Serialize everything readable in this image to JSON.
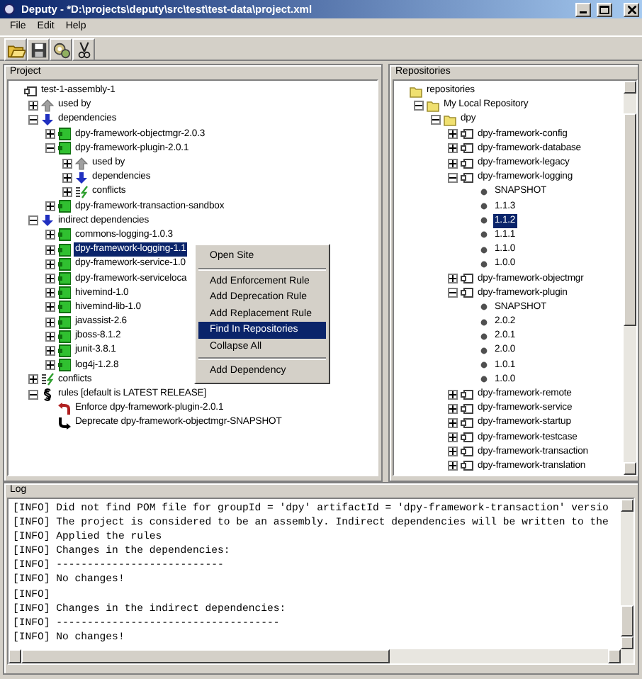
{
  "window": {
    "title": "Deputy - *D:\\projects\\deputy\\src\\test\\test-data\\project.xml"
  },
  "menu": [
    "File",
    "Edit",
    "Help"
  ],
  "toolbar": [
    {
      "kind": "open"
    },
    {
      "kind": "save"
    },
    {
      "kind": "resolve"
    },
    {
      "kind": "cut"
    }
  ],
  "project": {
    "title": "Project",
    "tree": [
      {
        "label": "test-1-assembly-1",
        "kind": "artifact",
        "selected": false,
        "children": [
          {
            "label": "used by",
            "kind": "up",
            "expanded": false,
            "selected": false
          },
          {
            "label": "dependencies",
            "kind": "down",
            "expanded": true,
            "selected": false,
            "children": [
              {
                "label": "dpy-framework-objectmgr-2.0.3",
                "kind": "module",
                "expanded": false,
                "selected": false
              },
              {
                "label": "dpy-framework-plugin-2.0.1",
                "kind": "module",
                "expanded": true,
                "selected": false,
                "children": [
                  {
                    "label": "used by",
                    "kind": "up",
                    "expanded": false,
                    "selected": false
                  },
                  {
                    "label": "dependencies",
                    "kind": "down",
                    "expanded": false,
                    "selected": false
                  },
                  {
                    "label": "conflicts",
                    "kind": "conflicts",
                    "expanded": false,
                    "selected": false
                  }
                ]
              },
              {
                "label": "dpy-framework-transaction-sandbox",
                "kind": "module",
                "expanded": false,
                "selected": false
              }
            ]
          },
          {
            "label": "indirect dependencies",
            "kind": "down",
            "expanded": true,
            "selected": false,
            "children": [
              {
                "label": "commons-logging-1.0.3",
                "kind": "module",
                "expanded": false,
                "selected": false
              },
              {
                "label": "dpy-framework-logging-1.1",
                "kind": "module",
                "expanded": false,
                "selected": true
              },
              {
                "label": "dpy-framework-service-1.0",
                "kind": "module",
                "expanded": false,
                "selected": false
              },
              {
                "label": "dpy-framework-serviceloca",
                "kind": "module",
                "expanded": false,
                "selected": false
              },
              {
                "label": "hivemind-1.0",
                "kind": "module",
                "expanded": false,
                "selected": false
              },
              {
                "label": "hivemind-lib-1.0",
                "kind": "module",
                "expanded": false,
                "selected": false
              },
              {
                "label": "javassist-2.6",
                "kind": "module",
                "expanded": false,
                "selected": false
              },
              {
                "label": "jboss-8.1.2",
                "kind": "module",
                "expanded": false,
                "selected": false
              },
              {
                "label": "junit-3.8.1",
                "kind": "module",
                "expanded": false,
                "selected": false
              },
              {
                "label": "log4j-1.2.8",
                "kind": "module",
                "expanded": false,
                "selected": false
              }
            ]
          },
          {
            "label": "conflicts",
            "kind": "conflicts",
            "expanded": false,
            "selected": false
          },
          {
            "label": "rules [default is LATEST RELEASE]",
            "kind": "rules",
            "expanded": true,
            "selected": false,
            "children": [
              {
                "label": "Enforce dpy-framework-plugin-2.0.1",
                "kind": "enforce",
                "selected": false
              },
              {
                "label": "Deprecate dpy-framework-objectmgr-SNAPSHOT",
                "kind": "deprecate",
                "selected": false
              }
            ]
          }
        ]
      }
    ]
  },
  "context_menu": {
    "items": [
      {
        "kind": "item",
        "label": "Open Site",
        "selected": false
      },
      {
        "kind": "separator"
      },
      {
        "kind": "item",
        "label": "Add Enforcement Rule",
        "selected": false
      },
      {
        "kind": "item",
        "label": "Add Deprecation Rule",
        "selected": false
      },
      {
        "kind": "item",
        "label": "Add Replacement Rule",
        "selected": false
      },
      {
        "kind": "item",
        "label": "Find In Repositories",
        "selected": true
      },
      {
        "kind": "item",
        "label": "Collapse All",
        "selected": false
      },
      {
        "kind": "separator"
      },
      {
        "kind": "item",
        "label": "Add Dependency",
        "selected": false
      }
    ]
  },
  "repositories": {
    "title": "Repositories",
    "tree": [
      {
        "label": "repositories",
        "kind": "folder",
        "selected": false,
        "children": [
          {
            "label": "My Local Repository",
            "kind": "folder",
            "expanded": true,
            "selected": false,
            "children": [
              {
                "label": "dpy",
                "kind": "folder",
                "expanded": true,
                "selected": false,
                "children": [
                  {
                    "label": "dpy-framework-config",
                    "kind": "artifact",
                    "expanded": false,
                    "selected": false
                  },
                  {
                    "label": "dpy-framework-database",
                    "kind": "artifact",
                    "expanded": false,
                    "selected": false
                  },
                  {
                    "label": "dpy-framework-legacy",
                    "kind": "artifact",
                    "expanded": false,
                    "selected": false
                  },
                  {
                    "label": "dpy-framework-logging",
                    "kind": "artifact",
                    "expanded": true,
                    "selected": false,
                    "children": [
                      {
                        "label": "SNAPSHOT",
                        "kind": "version",
                        "selected": false
                      },
                      {
                        "label": "1.1.3",
                        "kind": "version",
                        "selected": false
                      },
                      {
                        "label": "1.1.2",
                        "kind": "version",
                        "selected": true
                      },
                      {
                        "label": "1.1.1",
                        "kind": "version",
                        "selected": false
                      },
                      {
                        "label": "1.1.0",
                        "kind": "version",
                        "selected": false
                      },
                      {
                        "label": "1.0.0",
                        "kind": "version",
                        "selected": false
                      }
                    ]
                  },
                  {
                    "label": "dpy-framework-objectmgr",
                    "kind": "artifact",
                    "expanded": false,
                    "selected": false
                  },
                  {
                    "label": "dpy-framework-plugin",
                    "kind": "artifact",
                    "expanded": true,
                    "selected": false,
                    "children": [
                      {
                        "label": "SNAPSHOT",
                        "kind": "version",
                        "selected": false
                      },
                      {
                        "label": "2.0.2",
                        "kind": "version",
                        "selected": false
                      },
                      {
                        "label": "2.0.1",
                        "kind": "version",
                        "selected": false
                      },
                      {
                        "label": "2.0.0",
                        "kind": "version",
                        "selected": false
                      },
                      {
                        "label": "1.0.1",
                        "kind": "version",
                        "selected": false
                      },
                      {
                        "label": "1.0.0",
                        "kind": "version",
                        "selected": false
                      }
                    ]
                  },
                  {
                    "label": "dpy-framework-remote",
                    "kind": "artifact",
                    "expanded": false,
                    "selected": false
                  },
                  {
                    "label": "dpy-framework-service",
                    "kind": "artifact",
                    "expanded": false,
                    "selected": false
                  },
                  {
                    "label": "dpy-framework-startup",
                    "kind": "artifact",
                    "expanded": false,
                    "selected": false
                  },
                  {
                    "label": "dpy-framework-testcase",
                    "kind": "artifact",
                    "expanded": false,
                    "selected": false
                  },
                  {
                    "label": "dpy-framework-transaction",
                    "kind": "artifact",
                    "expanded": false,
                    "selected": false
                  },
                  {
                    "label": "dpy-framework-translation",
                    "kind": "artifact",
                    "expanded": false,
                    "selected": false
                  }
                ]
              }
            ]
          }
        ]
      }
    ]
  },
  "log": {
    "title": "Log",
    "lines": [
      "[INFO] Did not find POM file for groupId = 'dpy' artifactId = 'dpy-framework-transaction' versio",
      "[INFO] The project is considered to be an assembly. Indirect dependencies will be written to the",
      "[INFO] Applied the rules",
      "[INFO] Changes in the dependencies:",
      "[INFO] ---------------------------",
      "[INFO] No changes!",
      "[INFO]",
      "[INFO] Changes in the indirect dependencies:",
      "[INFO] ------------------------------------",
      "[INFO] No changes!"
    ]
  }
}
